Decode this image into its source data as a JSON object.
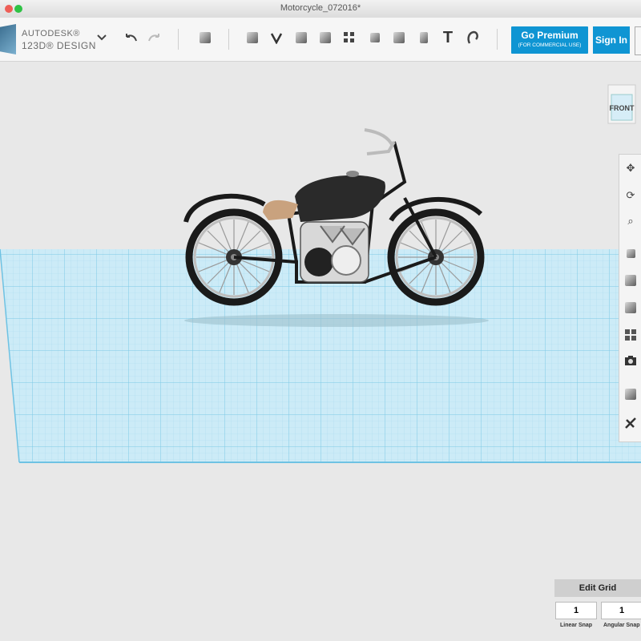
{
  "window": {
    "title": "Motorcycle_072016*"
  },
  "brand": {
    "line1": "AUTODESK®",
    "line2": "123D® DESIGN"
  },
  "toolbar": {
    "tools": [
      "dropdown-chevron-icon",
      "undo-icon",
      "redo-icon",
      "new-primitive-icon",
      "primitives-icon",
      "sketch-icon",
      "construct-icon",
      "modify-icon",
      "pattern-icon",
      "grouping-icon",
      "combine-icon",
      "measure-icon",
      "text-icon",
      "snap-icon"
    ]
  },
  "account": {
    "premium_label": "Go Premium",
    "premium_sub": "(FOR COMMERCIAL USE)",
    "signin_label": "Sign In"
  },
  "viewcube": {
    "face": "FRONT"
  },
  "nav": {
    "items": [
      "pan-icon",
      "orbit-icon",
      "zoom-icon",
      "fit-icon",
      "view-material-icon",
      "view-outline-icon",
      "visibility-icon",
      "screenshot-icon",
      "materials-icon",
      "appearance-icon"
    ]
  },
  "grid_panel": {
    "title": "Edit Grid",
    "linear_value": "1",
    "angular_value": "1",
    "linear_label": "Linear Snap",
    "angular_label": "Angular Snap"
  },
  "colors": {
    "accent": "#0f95d3",
    "grid": "#9ad6ee"
  }
}
